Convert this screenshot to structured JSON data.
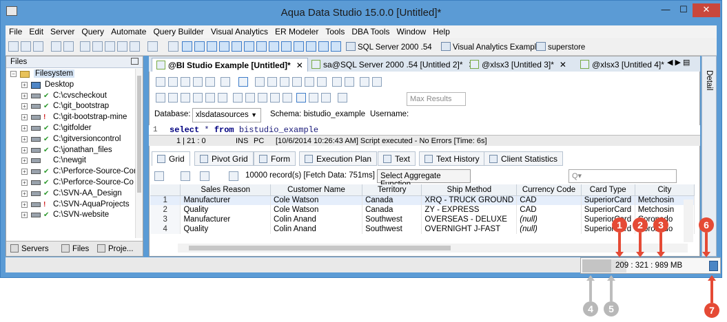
{
  "window": {
    "title": "Aqua Data Studio 15.0.0 [Untitled]*",
    "min": "—",
    "max": "☐",
    "close": "✕"
  },
  "menu": [
    "File",
    "Edit",
    "Server",
    "Query",
    "Automate",
    "Query Builder",
    "Visual Analytics",
    "ER Modeler",
    "Tools",
    "DBA Tools",
    "Window",
    "Help"
  ],
  "quicklinks": [
    "SQL Server 2000 .54",
    "Visual Analytics Example",
    "superstore"
  ],
  "files_panel": {
    "title": "Files",
    "root": "Filesystem",
    "desktop": "Desktop",
    "items": [
      {
        "label": "C:\\cvscheckout",
        "status": "ok"
      },
      {
        "label": "C:\\git_bootstrap",
        "status": "ok"
      },
      {
        "label": "C:\\git-bootstrap-mine",
        "status": "warn"
      },
      {
        "label": "C:\\gitfolder",
        "status": "ok"
      },
      {
        "label": "C:\\gitversioncontrol",
        "status": "ok"
      },
      {
        "label": "C:\\jonathan_files",
        "status": "ok"
      },
      {
        "label": "C:\\newgit",
        "status": "none"
      },
      {
        "label": "C:\\Perforce-Source-Cont",
        "status": "ok"
      },
      {
        "label": "C:\\Perforce-Source-Co",
        "status": "ok"
      },
      {
        "label": "C:\\SVN-AA_Design",
        "status": "ok"
      },
      {
        "label": "C:\\SVN-AquaProjects",
        "status": "warn"
      },
      {
        "label": "C:\\SVN-website",
        "status": "ok"
      }
    ],
    "bottom_tabs": [
      "Servers",
      "Files",
      "Proje..."
    ]
  },
  "doc_tabs": [
    {
      "label": "@BI Studio Example [Untitled]*",
      "active": true
    },
    {
      "label": "sa@SQL Server 2000 .54 [Untitled 2]*",
      "active": false
    },
    {
      "label": "@xlsx3 [Untitled 3]*",
      "active": false
    },
    {
      "label": "@xlsx3 [Untitled 4]*",
      "active": false
    }
  ],
  "editor": {
    "max_results_placeholder": "Max Results",
    "database_label": "Database:",
    "database_value": "xlsdatasources",
    "schema_text": "Schema:  bistudio_example",
    "username_label": "Username:",
    "line_number": "1",
    "sql_keyword1": "select",
    "sql_mid": " * ",
    "sql_keyword2": "from",
    "sql_rest": " bistudio_example",
    "status_pos": "1 | 21 : 0",
    "status_ins": "INS",
    "status_pc": "PC",
    "status_msg": "[10/6/2014 10:26:43 AM] Script executed - No Errors [Time: 6s]"
  },
  "result_tabs": [
    "Grid",
    "Pivot Grid",
    "Form",
    "Execution Plan",
    "Text",
    "Text History",
    "Client Statistics"
  ],
  "grid": {
    "record_count": "10000 record(s) [Fetch Data: 751ms]",
    "aggregate_button": "Select Aggregate Function",
    "columns": [
      "Sales Reason",
      "Customer Name",
      "Territory",
      "Ship Method",
      "Currency Code",
      "Card Type",
      "City"
    ],
    "rows": [
      {
        "n": "1",
        "cells": [
          "Manufacturer",
          "Cole Watson",
          "Canada",
          "XRQ - TRUCK GROUND",
          "CAD",
          "SuperiorCard",
          "Metchosin"
        ]
      },
      {
        "n": "2",
        "cells": [
          "Quality",
          "Cole Watson",
          "Canada",
          "ZY - EXPRESS",
          "CAD",
          "SuperiorCard",
          "Metchosin"
        ]
      },
      {
        "n": "3",
        "cells": [
          "Manufacturer",
          "Colin Anand",
          "Southwest",
          "OVERSEAS - DELUXE",
          "(null)",
          "SuperiorCard",
          "Coronado"
        ]
      },
      {
        "n": "4",
        "cells": [
          "Quality",
          "Colin Anand",
          "Southwest",
          "OVERNIGHT J-FAST",
          "(null)",
          "SuperiorCard",
          "Coronado"
        ]
      }
    ]
  },
  "detail_label": "Detail",
  "memory": {
    "text": "209 : 321 : 989 MB",
    "used_fraction": 0.21,
    "allocated_fraction": 0.32
  },
  "markers": [
    "1",
    "2",
    "3",
    "4",
    "5",
    "6",
    "7"
  ]
}
